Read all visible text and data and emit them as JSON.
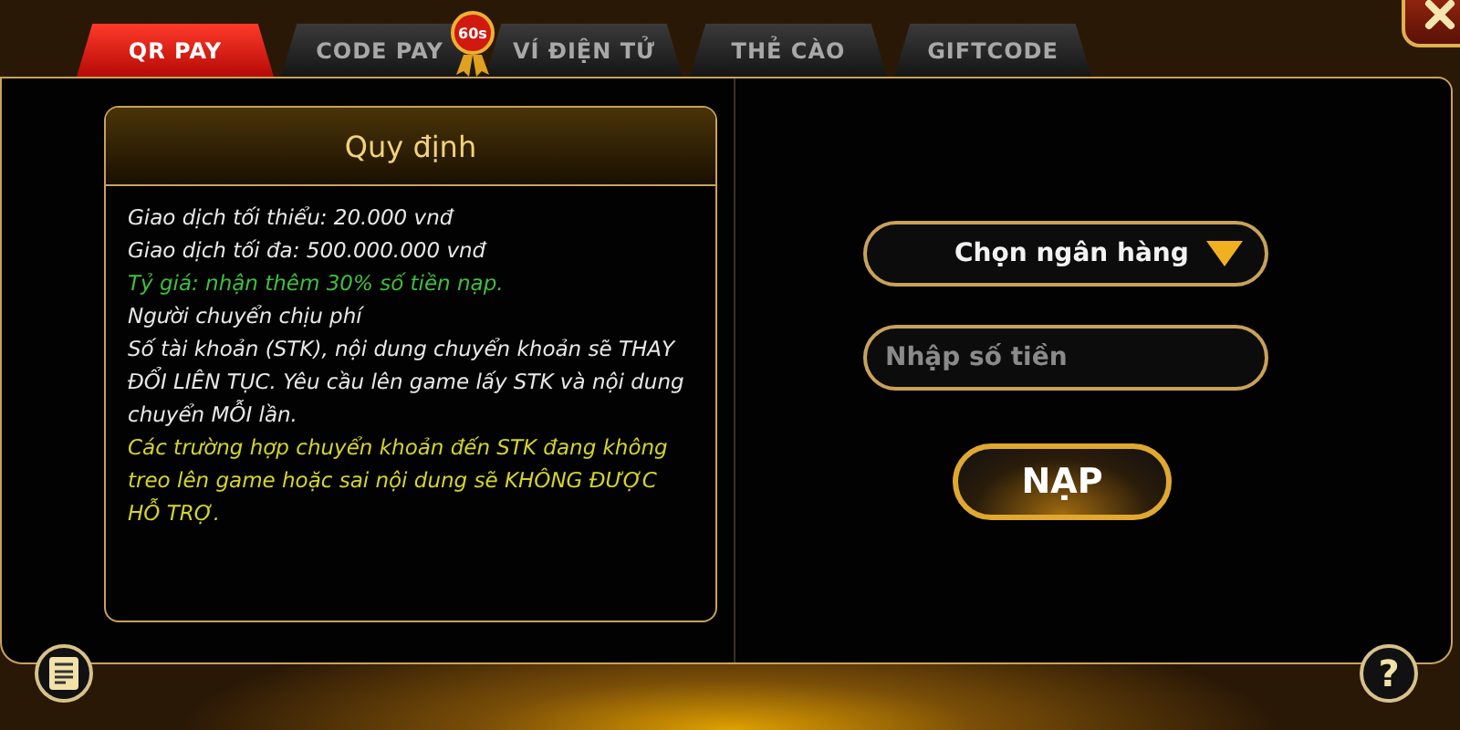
{
  "tabs": [
    {
      "label": "QR PAY",
      "selected": true
    },
    {
      "label": "CODE PAY",
      "selected": false
    },
    {
      "label": "VÍ ĐIỆN TỬ",
      "selected": false
    },
    {
      "label": "THẺ CÀO",
      "selected": false
    },
    {
      "label": "GIFTCODE",
      "selected": false
    }
  ],
  "timer_badge": "60s",
  "rules": {
    "title": "Quy định",
    "lines": [
      {
        "text": "Giao dịch tối thiểu: 20.000 vnđ",
        "color": "#e8e8e8"
      },
      {
        "text": "Giao dịch tối đa: 500.000.000 vnđ",
        "color": "#e8e8e8"
      },
      {
        "text": "Tỷ giá: nhận thêm 30% số tiền nạp.",
        "color": "#3fbf3f"
      },
      {
        "text": "Người chuyển chịu phí",
        "color": "#e8e8e8"
      },
      {
        "text": "Số tài khoản (STK), nội dung chuyển khoản sẽ THAY ĐỔI LIÊN TỤC. Yêu cầu lên game lấy STK và nội dung chuyển MỖI lần.",
        "color": "#e8e8e8"
      },
      {
        "text": "Các trường hợp chuyển khoản đến STK đang không treo lên game hoặc sai nội dung sẽ KHÔNG ĐƯỢC HỖ TRỢ.",
        "color": "#d4d42a"
      }
    ]
  },
  "bank_select": {
    "label": "Chọn ngân hàng"
  },
  "amount_field": {
    "placeholder": "Nhập số tiền"
  },
  "submit_button": "NẠP",
  "help_button": "?"
}
